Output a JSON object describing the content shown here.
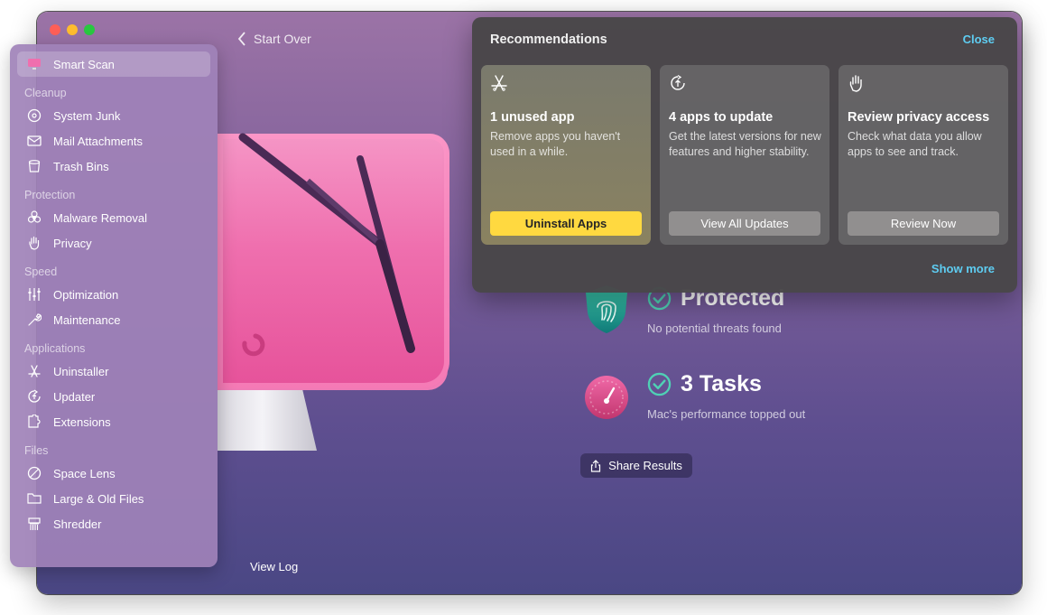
{
  "window": {
    "start_over": "Start Over",
    "view_log": "View Log"
  },
  "sidebar": {
    "active": "Smart Scan",
    "smart_scan": {
      "label": "Smart Scan",
      "icon": "monitor-icon"
    },
    "sections": [
      {
        "title": "Cleanup",
        "items": [
          {
            "label": "System Junk",
            "icon": "disk-icon"
          },
          {
            "label": "Mail Attachments",
            "icon": "mail-icon"
          },
          {
            "label": "Trash Bins",
            "icon": "trash-icon"
          }
        ]
      },
      {
        "title": "Protection",
        "items": [
          {
            "label": "Malware Removal",
            "icon": "biohazard-icon"
          },
          {
            "label": "Privacy",
            "icon": "hand-icon"
          }
        ]
      },
      {
        "title": "Speed",
        "items": [
          {
            "label": "Optimization",
            "icon": "sliders-icon"
          },
          {
            "label": "Maintenance",
            "icon": "wrench-icon"
          }
        ]
      },
      {
        "title": "Applications",
        "items": [
          {
            "label": "Uninstaller",
            "icon": "app-icon"
          },
          {
            "label": "Updater",
            "icon": "update-icon"
          },
          {
            "label": "Extensions",
            "icon": "puzzle-icon"
          }
        ]
      },
      {
        "title": "Files",
        "items": [
          {
            "label": "Space Lens",
            "icon": "lens-icon"
          },
          {
            "label": "Large & Old Files",
            "icon": "folder-icon"
          },
          {
            "label": "Shredder",
            "icon": "shredder-icon"
          }
        ]
      }
    ]
  },
  "results": {
    "protected_title": "Protected",
    "protected_sub": "No potential threats found",
    "tasks_title": "3 Tasks",
    "tasks_sub": "Mac's performance topped out",
    "share": "Share Results"
  },
  "recommendations": {
    "title": "Recommendations",
    "close": "Close",
    "show_more": "Show more",
    "cards": [
      {
        "title": "1 unused app",
        "desc": "Remove apps you haven't used in a while.",
        "button": "Uninstall Apps",
        "icon": "app-store-icon"
      },
      {
        "title": "4 apps to update",
        "desc": "Get the latest versions for new features and higher stability.",
        "button": "View All Updates",
        "icon": "update-icon"
      },
      {
        "title": "Review privacy access",
        "desc": "Check what data you allow apps to see and track.",
        "button": "Review Now",
        "icon": "hand-icon"
      }
    ]
  },
  "colors": {
    "accent_link": "#5ecdf2",
    "primary_button": "#ffd940",
    "check_green": "#4fd1b5"
  }
}
